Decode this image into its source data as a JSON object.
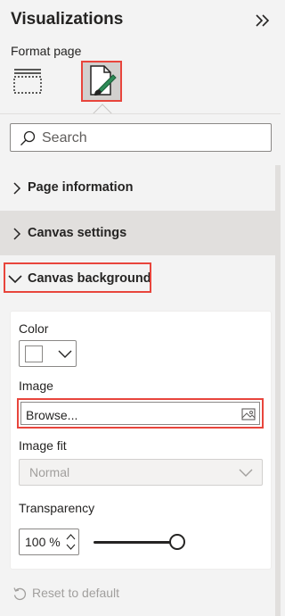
{
  "pane": {
    "title": "Visualizations",
    "subtitle": "Format page"
  },
  "search": {
    "placeholder": "Search"
  },
  "sections": {
    "page_information": "Page information",
    "canvas_settings": "Canvas settings",
    "canvas_background": "Canvas background"
  },
  "background": {
    "color_label": "Color",
    "color_value": "#ffffff",
    "image_label": "Image",
    "image_value": "Browse...",
    "image_fit_label": "Image fit",
    "image_fit_value": "Normal",
    "transparency_label": "Transparency",
    "transparency_value": "100 %",
    "transparency_level": 100
  },
  "reset_label": "Reset to default",
  "colors": {
    "highlight": "#e8453c",
    "pane_bg": "#f3f3f3",
    "card_bg": "#ffffff",
    "disabled_text": "#a19f9d"
  }
}
